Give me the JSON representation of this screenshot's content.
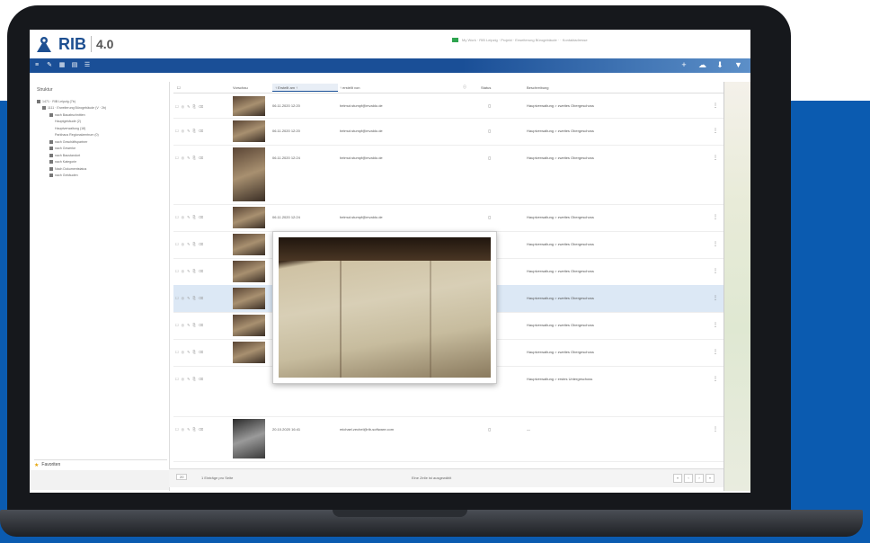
{
  "app": {
    "brand": "RIB",
    "version": "4.0",
    "top_right_text": "My Work · RIB Leipzig · Projekt · Erweiterung Bürogebäude · ·   Kontaktadresse"
  },
  "toolbar": {
    "left_icons": [
      "menu-icon",
      "wrench-icon",
      "grid-icon",
      "document-icon",
      "list-icon"
    ],
    "right_icons": [
      "plus-icon",
      "cloud-upload-icon",
      "download-icon",
      "filter-icon"
    ]
  },
  "sidebar": {
    "title": "Struktur",
    "tree": [
      "1471 · RIB Leipzig (7b)",
      "1111 · Erweiterung Bürogebäude (V · 2b)",
      "nach Bauabschnitten",
      "Hauptgebäude (2)",
      "Hauptverwaltung (18)",
      "Parkhaus Regionalzentrum (0)",
      "nach Geschäftspartner",
      "nach Gewerke",
      "nach Baustandort",
      "nach Kategorie",
      "Nach Dokumentstatus",
      "nach Gebäuden"
    ],
    "favorites_label": "Favoriten"
  },
  "grid": {
    "columns": [
      "Vorschau",
      "↑ Erstellt am ↑",
      "↑ erstellt von",
      "Status",
      "Beschreibung"
    ],
    "rows": [
      {
        "date": "06.11.2020 12:20",
        "user": "helmut.stumpf@mvaldo.de",
        "desc": "Hauptverwaltung > zweites Obergeschoss"
      },
      {
        "date": "06.11.2020 12:20",
        "user": "helmut.stumpf@mvaldo.de",
        "desc": "Hauptverwaltung > zweites Obergeschoss"
      },
      {
        "date": "06.11.2020 12:24",
        "user": "helmut.stumpf@mvaldo.de",
        "desc": "Hauptverwaltung > zweites Obergeschoss"
      },
      {
        "date": "06.11.2020 12:24",
        "user": "helmut.stumpf@mvaldo.de",
        "desc": "Hauptverwaltung > zweites Obergeschoss"
      },
      {
        "date": "",
        "user": "",
        "desc": "Hauptverwaltung > zweites Obergeschoss"
      },
      {
        "date": "",
        "user": "",
        "desc": "Hauptverwaltung > zweites Obergeschoss"
      },
      {
        "date": "",
        "user": "",
        "desc": "Hauptverwaltung > zweites Obergeschoss"
      },
      {
        "date": "",
        "user": "",
        "desc": "Hauptverwaltung > zweites Obergeschoss"
      },
      {
        "date": "",
        "user": "",
        "desc": "Hauptverwaltung > zweites Obergeschoss"
      },
      {
        "date": "",
        "user": "",
        "desc": "Hauptverwaltung > erstes Untergeschoss"
      },
      {
        "date": "20.10.2020 16:41",
        "user": "michael.zechel@rib-software.com",
        "desc": "—"
      }
    ]
  },
  "status_bar": {
    "page_size": "20",
    "count_text": "1 Einträge pro Seite",
    "center_text": "Eine Zeile ist ausgewählt"
  },
  "colors": {
    "brand_blue": "#1a4f97",
    "background_blue": "#0b5bb0",
    "highlight_row": "#dce8f5"
  }
}
